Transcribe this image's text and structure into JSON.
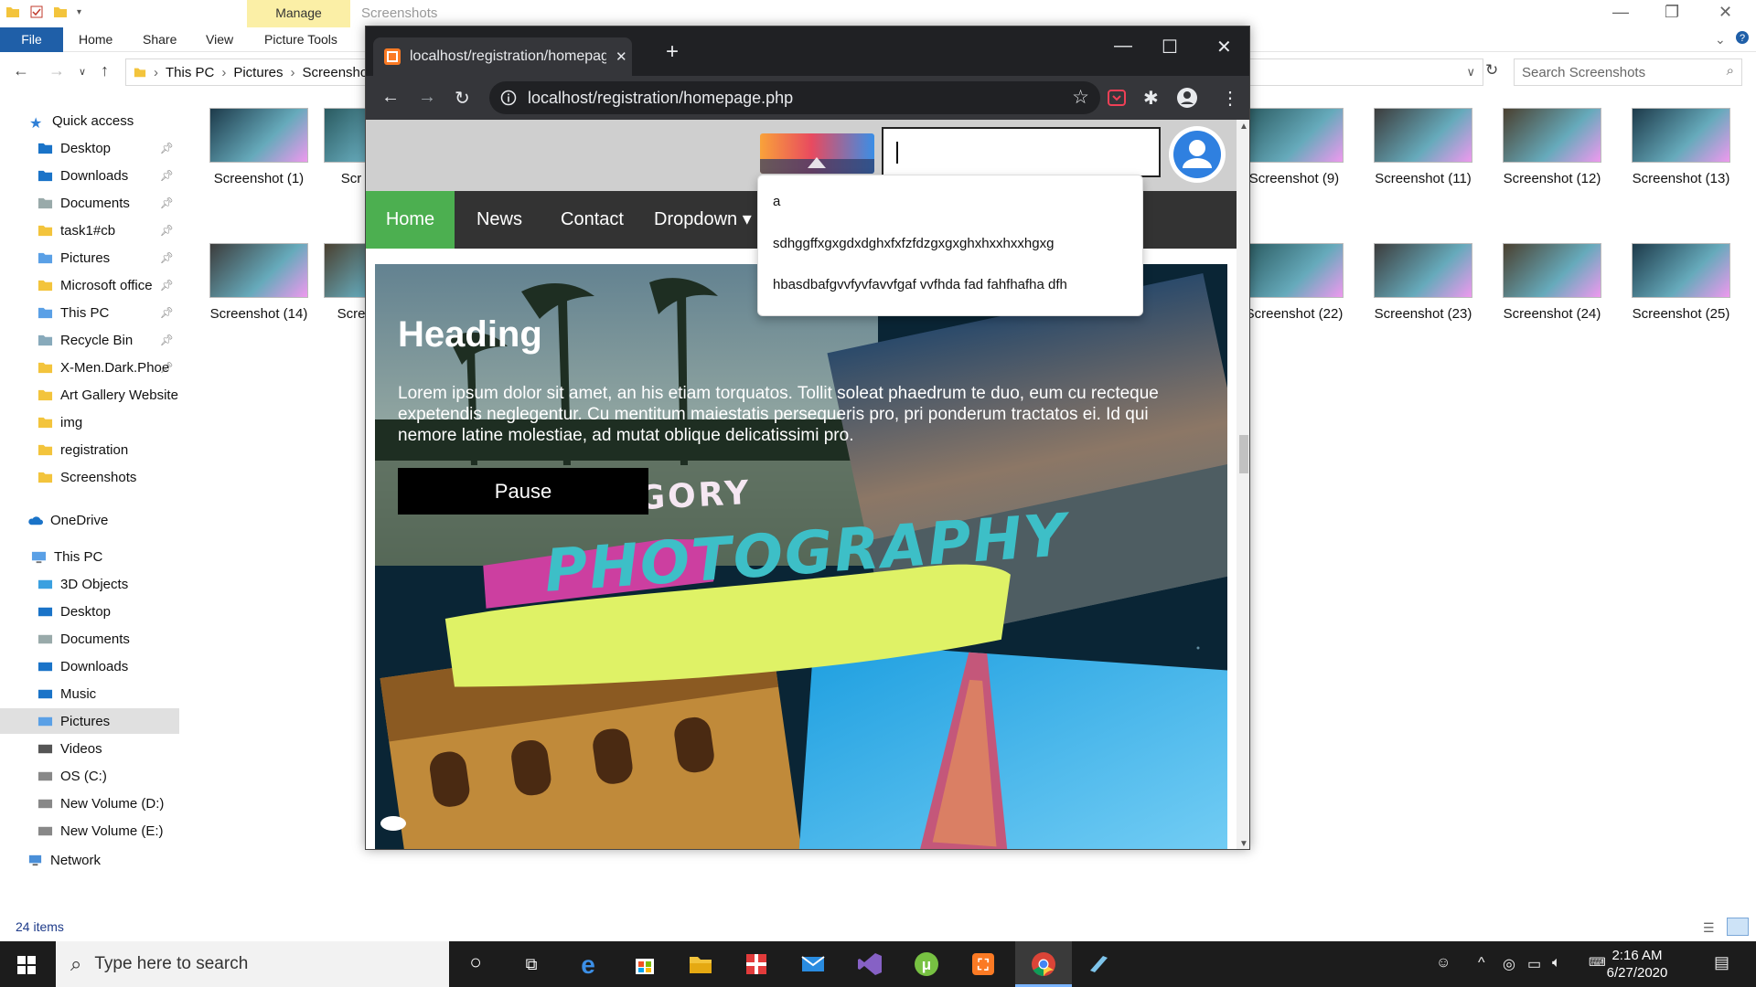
{
  "explorer": {
    "title": "Screenshots",
    "ribbon": {
      "file": "File",
      "home": "Home",
      "share": "Share",
      "view": "View",
      "manage": "Manage",
      "picture_tools": "Picture Tools"
    },
    "breadcrumb": [
      "This PC",
      "Pictures",
      "Screensho"
    ],
    "search_placeholder": "Search Screenshots",
    "quick_access": "Quick access",
    "sidebar": [
      {
        "label": "Desktop",
        "pinned": true
      },
      {
        "label": "Downloads",
        "pinned": true
      },
      {
        "label": "Documents",
        "pinned": true
      },
      {
        "label": "task1#cb",
        "pinned": true
      },
      {
        "label": "Pictures",
        "pinned": true
      },
      {
        "label": "Microsoft office",
        "pinned": true
      },
      {
        "label": "This PC",
        "pinned": true
      },
      {
        "label": "Recycle Bin",
        "pinned": true
      },
      {
        "label": "X-Men.Dark.Phoe",
        "pinned": true
      },
      {
        "label": "Art Gallery Website",
        "pinned": false
      },
      {
        "label": "img",
        "pinned": false
      },
      {
        "label": "registration",
        "pinned": false
      },
      {
        "label": "Screenshots",
        "pinned": false
      }
    ],
    "onedrive": "OneDrive",
    "this_pc": "This PC",
    "pc_items": [
      "3D Objects",
      "Desktop",
      "Documents",
      "Downloads",
      "Music",
      "Pictures",
      "Videos",
      "OS (C:)",
      "New Volume (D:)",
      "New Volume (E:)"
    ],
    "network": "Network",
    "thumbnails_left": [
      "Screenshot (1)",
      "Scr",
      "Screenshot (14)",
      "Scre"
    ],
    "thumbnails_right": [
      "Screenshot (9)",
      "Screenshot (11)",
      "Screenshot (12)",
      "Screenshot (13)",
      "Screenshot (22)",
      "Screenshot (23)",
      "Screenshot (24)",
      "Screenshot (25)"
    ],
    "status": "24 items"
  },
  "browser": {
    "tab_title": "localhost/registration/homepage",
    "url": "localhost/registration/homepage.php"
  },
  "site": {
    "search_value": "",
    "nav": [
      "Home",
      "News",
      "Contact",
      "Dropdown"
    ],
    "suggestions": [
      "a",
      "sdhggffxgxgdxdghxfxfzfdzgxgxghxhxxhxxhgxg",
      "hbasdbafgvvfyvfavvfgaf vvfhda fad fahfhafha dfh"
    ],
    "hero": {
      "heading": "Heading",
      "text": "Lorem ipsum dolor sit amet, an his etiam torquatos. Tollit soleat phaedrum te duo, eum cu recteque expetendis neglegentur. Cu mentitum maiestatis persequeris pro, pri ponderum tractatos ei. Id qui nemore latine molestiae, ad mutat oblique delicatissimi pro.",
      "button": "Pause",
      "category": "CATEGORY",
      "title": "PHOTOGRAPHY"
    }
  },
  "taskbar": {
    "search_placeholder": "Type here to search",
    "time": "2:16 AM",
    "date": "6/27/2020"
  },
  "colors": {
    "nav_active": "#4caf50",
    "nav_bg": "#333333",
    "explorer_file_tab": "#1f5fa8",
    "manage_tab": "#fbefa6",
    "category_pink": "#cc3fa0",
    "title_yellow": "#dff266",
    "title_teal": "#3dbfc7"
  }
}
